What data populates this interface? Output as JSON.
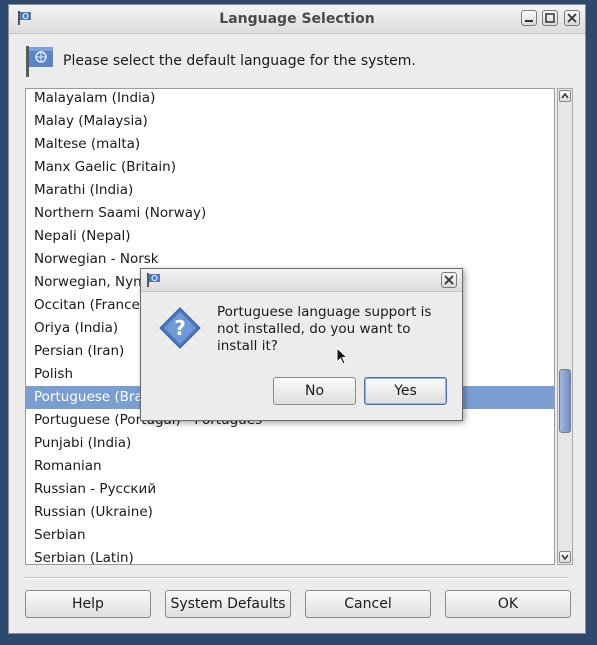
{
  "window": {
    "title": "Language Selection"
  },
  "header": {
    "message": "Please select the default language for the system."
  },
  "languages": [
    "Malayalam (India)",
    "Malay (Malaysia)",
    "Maltese (malta)",
    "Manx Gaelic (Britain)",
    "Marathi (India)",
    "Northern Saami (Norway)",
    "Nepali (Nepal)",
    "Norwegian - Norsk",
    "Norwegian, Nynorsk (Norway)",
    "Occitan (France)",
    "Oriya (India)",
    "Persian (Iran)",
    "Polish",
    "Portuguese (Brazil)",
    "Portuguese (Portugal) - Português",
    "Punjabi (India)",
    "Romanian",
    "Russian - Русский",
    "Russian (Ukraine)",
    "Serbian",
    "Serbian (Latin)"
  ],
  "selected_language": "Portuguese (Brazil)",
  "buttons": {
    "help": "Help",
    "system_defaults": "System Defaults",
    "cancel": "Cancel",
    "ok": "OK"
  },
  "dialog": {
    "message": "Portuguese language support is not installed, do you want to install it?",
    "no": "No",
    "yes": "Yes"
  },
  "colors": {
    "selection": "#7b9ed2",
    "desktop": "#2d4a6e"
  }
}
